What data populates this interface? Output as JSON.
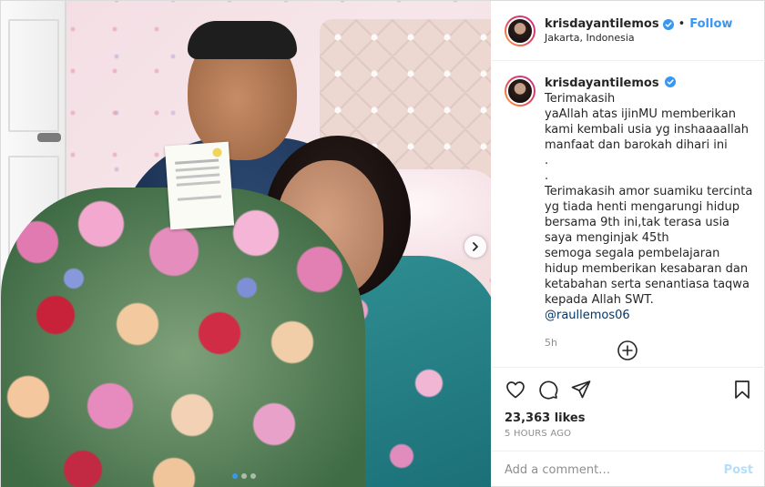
{
  "post": {
    "username": "krisdayantilemos",
    "follow_label": "Follow",
    "separator": "•",
    "location": "Jakarta, Indonesia",
    "caption": {
      "text_lines": "Terimakasih\nyaAllah atas ijinMU memberikan kami kembali usia yg inshaaaallah manfaat dan barokah dihari ini\n.\n.\nTerimakasih amor suamiku tercinta yg tiada henti mengarungi hidup bersama 9th ini,tak terasa usia saya menginjak 45th\nsemoga segala pembelajaran hidup memberikan kesabaran dan ketabahan serta senantiasa taqwa kepada Allah SWT.",
      "mention": "@raullemos06",
      "time": "5h"
    },
    "likes": "23,363 likes",
    "timestamp": "5 HOURS AGO",
    "comment_placeholder": "Add a comment…",
    "post_button": "Post"
  },
  "carousel": {
    "slide_count": 3,
    "active_index": 0
  },
  "colors": {
    "accent": "#3897f0",
    "post_disabled": "#b2dffc",
    "verified": "#3897f0"
  },
  "icons": {
    "verified": "verified-badge-icon",
    "like": "heart-icon",
    "comment": "comment-icon",
    "share": "paper-plane-icon",
    "save": "bookmark-icon",
    "more": "plus-circle-icon",
    "next": "chevron-right-icon"
  }
}
